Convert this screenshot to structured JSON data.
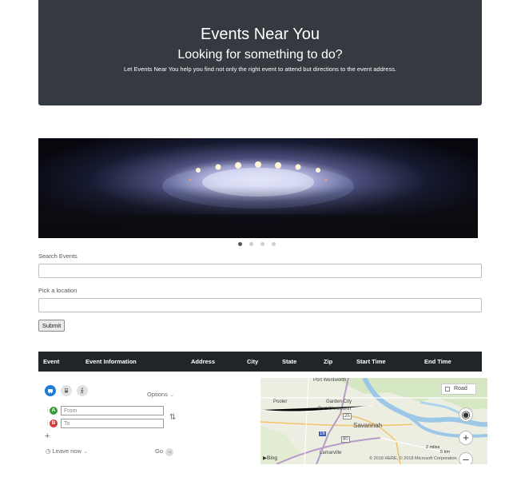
{
  "hero": {
    "title": "Events Near You",
    "subtitle": "Looking for something to do?",
    "description": "Let Events Near You help you find not only the right event to attend but directions to the event address."
  },
  "carousel": {
    "slide_count": 4,
    "active_index": 0
  },
  "search": {
    "events_label": "Search Events",
    "events_value": "",
    "location_label": "Pick a location",
    "location_value": "",
    "submit_label": "Submit"
  },
  "table": {
    "headers": [
      "Event",
      "Event Information",
      "Address",
      "City",
      "State",
      "Zip",
      "Start Time",
      "End Time"
    ]
  },
  "directions": {
    "modes": [
      "car-icon",
      "bus-icon",
      "walk-icon"
    ],
    "active_mode": "car-icon",
    "options_label": "Options",
    "from_letter": "A",
    "to_letter": "B",
    "from_placeholder": "From",
    "to_placeholder": "To",
    "add_waypoint": "+",
    "leave_label": "Leave now",
    "go_label": "Go"
  },
  "map": {
    "style_label": "Road",
    "labels": [
      "Port Wentworth",
      "Pooler",
      "Garden City",
      "Port Wentworth",
      "Savannah",
      "Lamarville"
    ],
    "highway_shields": [
      "25",
      "16",
      "80"
    ],
    "scale_miles": "2 miles",
    "scale_km": "5 km",
    "copyright": "© 2018 HERE, © 2018 Microsoft Corporation",
    "brand": "Bing"
  },
  "colors": {
    "hero_bg": "#343a40",
    "table_header_bg": "#212529",
    "active_mode": "#1e7cd6",
    "waypoint_a": "#3a9b3a",
    "waypoint_b": "#d33a3a"
  }
}
